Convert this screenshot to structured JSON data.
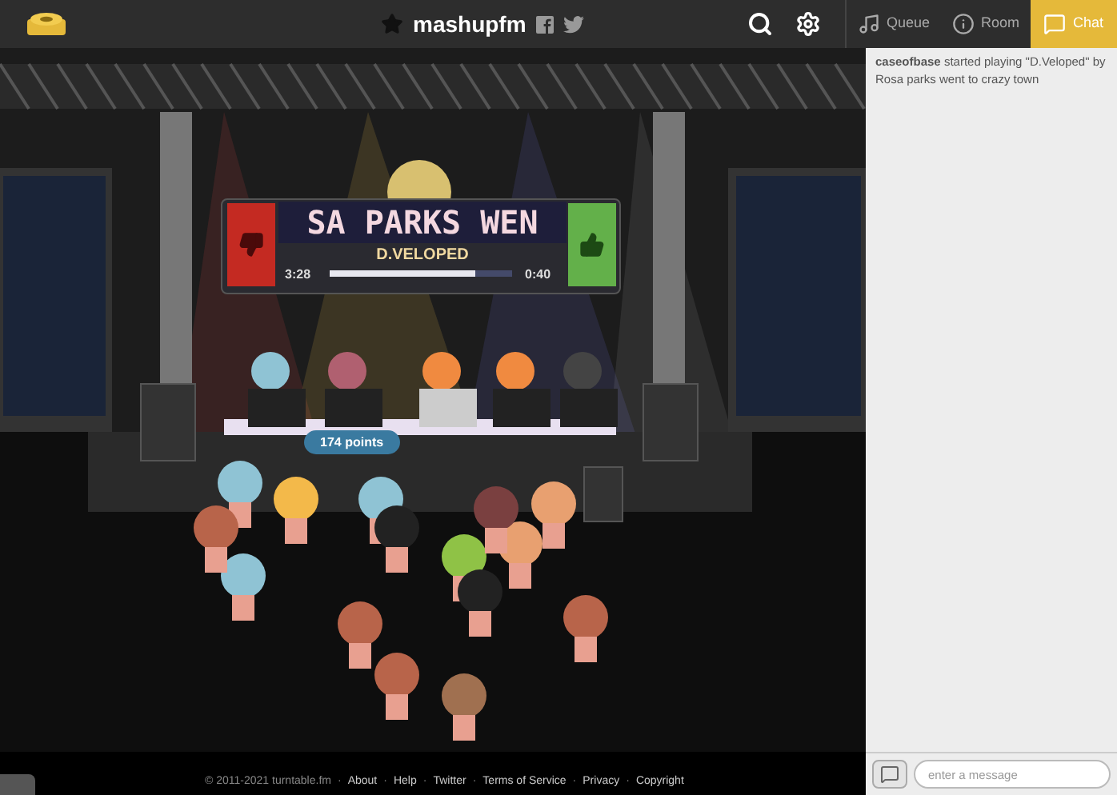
{
  "header": {
    "room_name": "mashupfm"
  },
  "chat_tabs": [
    {
      "label": "Queue",
      "kind": "queue",
      "selected": false
    },
    {
      "label": "Room",
      "kind": "room",
      "selected": false
    },
    {
      "label": "Chat",
      "kind": "chat",
      "selected": true
    }
  ],
  "chat_messages": [
    "**caseofbase** started playing \"D.Veloped\" by Rosa parks went to crazy town"
  ],
  "chat_input": {
    "placeholder": "enter a message"
  },
  "now_playing": {
    "title": "SA PARKS WEN",
    "artist": "D.VELOPED",
    "elapsed": "3:28",
    "remaining": "0:40",
    "level": 0.8
  },
  "dj_points": "174 points",
  "footer": {
    "copyright": "© 2011-2021 turntable.fm",
    "separator": "·",
    "links": [
      "About",
      "Help",
      "Twitter",
      "Terms of Service",
      "Privacy",
      "Copyright"
    ]
  }
}
